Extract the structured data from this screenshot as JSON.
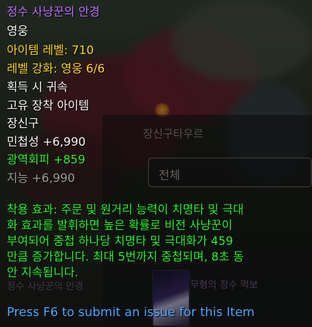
{
  "item": {
    "name": "정수 사냥꾼의 안경",
    "quality": "영웅",
    "item_level": "아이템 레벨: 710",
    "upgrade": "레벨 강화: 영웅 6/6",
    "binding": "획득 시 귀속",
    "unique": "고유 장착 아이템",
    "slot": "장신구",
    "stat_agility": "민첩성 +6,990",
    "stat_avoidance": "광역회피 +859",
    "stat_intellect": "지능 +6,990",
    "effect_lines": [
      "착용 효과: 주문 및 원거리 능력이 치명타 및 극대",
      "화 효과를 발휘하면 높은 확률로 비전 사냥꾼이",
      "부여되어 중첩 하나당 치명타 및 극대화가 459",
      "만큼 증가합니다. 최대 5번까지 중첩되며, 8초 동",
      "안 지속됩니다."
    ]
  },
  "footer": {
    "report": "Press F6 to submit an issue for this Item"
  },
  "background_window": {
    "title": "장신구타우르",
    "dropdown_value": "전체",
    "list_left_text": "정수 사냥꾼의 안경",
    "list_right_text": "무형의 정수 먹보"
  },
  "colors": {
    "epic": "#c56bff",
    "item_level": "#ffd21a",
    "bonus_stat": "#27f42a",
    "inactive_stat": "#9d9d9d",
    "link": "#4aa6ff"
  }
}
